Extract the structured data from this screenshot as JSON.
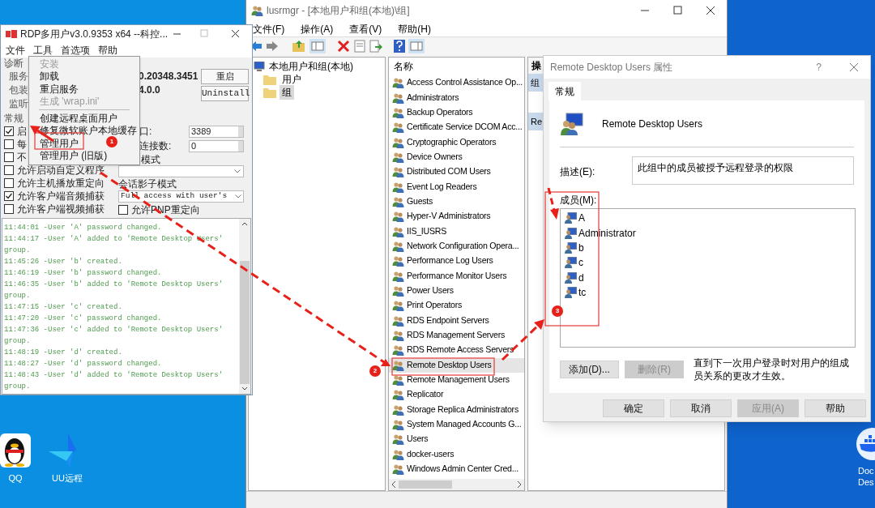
{
  "desktop": {
    "icons": [
      {
        "kind": "qq",
        "label": "QQ"
      },
      {
        "kind": "uu",
        "label": "UU远程"
      },
      {
        "kind": "docker",
        "label": "Doc\nDes"
      }
    ]
  },
  "rdp_window": {
    "title": "RDP多用户v3.0.9353 x64 --科控...",
    "menu": [
      "文件",
      "工具",
      "首选项",
      "帮助"
    ],
    "tools_menu": [
      {
        "kind": "item",
        "label": "安装",
        "disabled": true
      },
      {
        "kind": "item",
        "label": "卸载",
        "disabled": false
      },
      {
        "kind": "item",
        "label": "重启服务",
        "disabled": false
      },
      {
        "kind": "item",
        "label": "生成 'wrap.ini'",
        "disabled": true
      },
      {
        "kind": "separator"
      },
      {
        "kind": "item",
        "label": "创建远程桌面用户",
        "disabled": false
      },
      {
        "kind": "item",
        "label": "修复微软账户本地缓存",
        "disabled": false
      },
      {
        "kind": "item",
        "label": "管理用户",
        "disabled": false
      },
      {
        "kind": "item",
        "label": "管理用户 (旧版)",
        "disabled": false
      }
    ],
    "diagnostics": {
      "label": "诊断",
      "rows": [
        {
          "label": "服务",
          "value": "0.20348.3451"
        },
        {
          "label": "包装",
          "value": "4.0.0"
        },
        {
          "label": "监听"
        }
      ],
      "buttons": [
        "重启",
        "Uninstall"
      ]
    },
    "settings": {
      "label": "常规",
      "checkboxes": [
        {
          "label": "启",
          "checked": true
        },
        {
          "label": "每",
          "checked": false
        },
        {
          "label": "不",
          "checked": false
        },
        {
          "label": "允许启动自定义程序",
          "checked": false
        },
        {
          "label": "允许主机播放重定向",
          "checked": false
        },
        {
          "label": "允许客户端音频捕获",
          "checked": true
        },
        {
          "label": "允许客户端视频捕获",
          "checked": false
        }
      ],
      "port_label": "口:",
      "port": "3389",
      "connections_label": "连接数:",
      "connections": "0",
      "auth_label": "模式",
      "shadow_label": "会话影子模式",
      "shadow_value": "Full access with user's",
      "pnp": {
        "label": "允许PNP重定向",
        "checked": false
      }
    },
    "log": [
      "11:44:01 -User 'A' password changed.",
      "11:44:17 -User 'A' added to 'Remote Desktop Users' group.",
      "11:45:26 -User 'b' created.",
      "11:46:19 -User 'b' password changed.",
      "11:46:35 -User 'b' added to 'Remote Desktop Users' group.",
      "11:47:15 -User 'c' created.",
      "11:47:20 -User 'c' password changed.",
      "11:47:36 -User 'c' added to 'Remote Desktop Users' group.",
      "11:48:19 -User 'd' created.",
      "11:48:27 -User 'd' password changed.",
      "11:48:43 -User 'd' added to 'Remote Desktop Users' group."
    ]
  },
  "lusrmgr": {
    "title": "lusrmgr - [本地用户和组(本地)\\组]",
    "menu": [
      "文件(F)",
      "操作(A)",
      "查看(V)",
      "帮助(H)"
    ],
    "tree": [
      {
        "label": "本地用户和组(本地)",
        "children": [
          {
            "label": "用户",
            "selected": false
          },
          {
            "label": "组",
            "selected": true
          }
        ]
      }
    ],
    "list_header": "名称",
    "groups": [
      {
        "label": "Access Control Assistance Op...",
        "selected": false
      },
      {
        "label": "Administrators",
        "selected": false
      },
      {
        "label": "Backup Operators",
        "selected": false
      },
      {
        "label": "Certificate Service DCOM Acc...",
        "selected": false
      },
      {
        "label": "Cryptographic Operators",
        "selected": false
      },
      {
        "label": "Device Owners",
        "selected": false
      },
      {
        "label": "Distributed COM Users",
        "selected": false
      },
      {
        "label": "Event Log Readers",
        "selected": false
      },
      {
        "label": "Guests",
        "selected": false
      },
      {
        "label": "Hyper-V Administrators",
        "selected": false
      },
      {
        "label": "IIS_IUSRS",
        "selected": false
      },
      {
        "label": "Network Configuration Opera...",
        "selected": false
      },
      {
        "label": "Performance Log Users",
        "selected": false
      },
      {
        "label": "Performance Monitor Users",
        "selected": false
      },
      {
        "label": "Power Users",
        "selected": false
      },
      {
        "label": "Print Operators",
        "selected": false
      },
      {
        "label": "RDS Endpoint Servers",
        "selected": false
      },
      {
        "label": "RDS Management Servers",
        "selected": false
      },
      {
        "label": "RDS Remote Access Servers",
        "selected": false
      },
      {
        "label": "Remote Desktop Users",
        "selected": true
      },
      {
        "label": "Remote Management Users",
        "selected": false
      },
      {
        "label": "Replicator",
        "selected": false
      },
      {
        "label": "Storage Replica Administrators",
        "selected": false
      },
      {
        "label": "System Managed Accounts G...",
        "selected": false
      },
      {
        "label": "Users",
        "selected": false
      },
      {
        "label": "docker-users",
        "selected": false
      },
      {
        "label": "Windows Admin Center Cred...",
        "selected": false
      }
    ],
    "actions_header": "操",
    "actions": [
      "组",
      "Re"
    ]
  },
  "dialog": {
    "title": "Remote Desktop Users 属性",
    "help": "?",
    "tabs": [
      {
        "label": "常规",
        "selected": true
      }
    ],
    "group_name": "Remote Desktop Users",
    "description_label": "描述(E):",
    "description": "此组中的成员被授予远程登录的权限",
    "members_label": "成员(M):",
    "members": [
      "A",
      "Administrator",
      "b",
      "c",
      "d",
      "tc"
    ],
    "add_button": {
      "label": "添加(D)...",
      "disabled": false
    },
    "remove_button": {
      "label": "删除(R)",
      "disabled": true
    },
    "note": "直到下一次用户登录时对用户的组成员关系的更改才生效。",
    "footer_buttons": [
      {
        "label": "确定",
        "disabled": false
      },
      {
        "label": "取消",
        "disabled": false
      },
      {
        "label": "应用(A)",
        "disabled": true
      },
      {
        "label": "帮助",
        "disabled": false
      }
    ]
  },
  "annotations": {
    "badges": [
      "1",
      "2",
      "3"
    ]
  }
}
